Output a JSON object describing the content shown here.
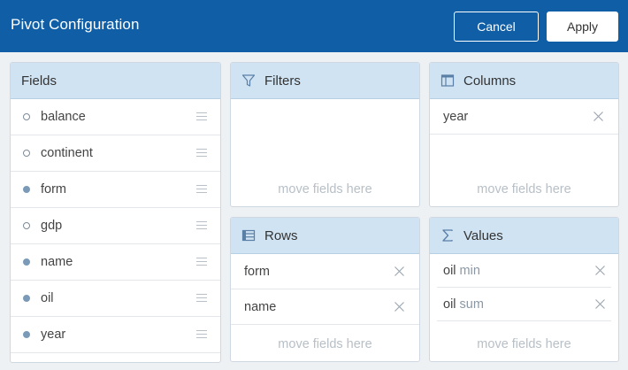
{
  "header": {
    "title": "Pivot Configuration",
    "cancel_label": "Cancel",
    "apply_label": "Apply",
    "bg_color": "#0f5ea6"
  },
  "fields_panel": {
    "title": "Fields",
    "items": [
      {
        "label": "balance",
        "marker": "empty"
      },
      {
        "label": "continent",
        "marker": "empty"
      },
      {
        "label": "form",
        "marker": "filled"
      },
      {
        "label": "gdp",
        "marker": "empty"
      },
      {
        "label": "name",
        "marker": "filled"
      },
      {
        "label": "oil",
        "marker": "filled"
      },
      {
        "label": "year",
        "marker": "filled"
      }
    ]
  },
  "filters_panel": {
    "title": "Filters",
    "icon": "filter-icon",
    "placeholder": "move fields here"
  },
  "columns_panel": {
    "title": "Columns",
    "icon": "columns-icon",
    "items": [
      {
        "label": "year"
      }
    ],
    "placeholder": "move fields here"
  },
  "rows_panel": {
    "title": "Rows",
    "icon": "rows-icon",
    "items": [
      {
        "label": "form"
      },
      {
        "label": "name"
      }
    ],
    "placeholder": "move fields here"
  },
  "values_panel": {
    "title": "Values",
    "icon": "sigma-icon",
    "items": [
      {
        "label": "oil",
        "aggregation": "min"
      },
      {
        "label": "oil",
        "aggregation": "sum"
      }
    ],
    "placeholder": "move fields here"
  }
}
